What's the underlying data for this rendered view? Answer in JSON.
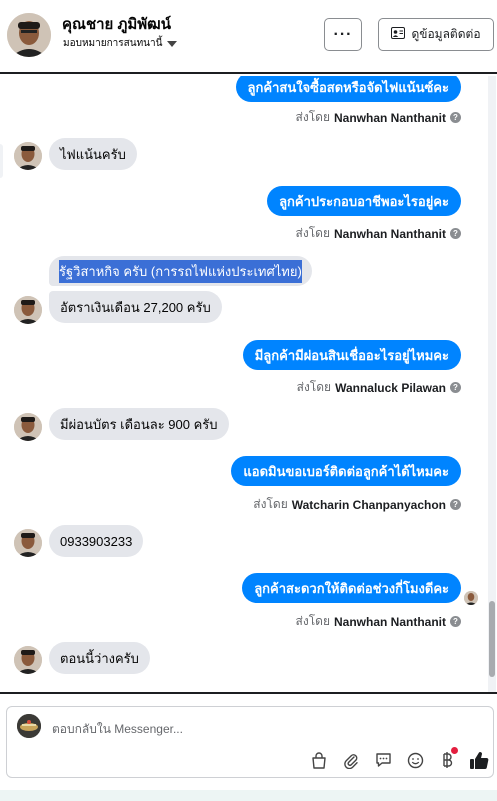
{
  "header": {
    "contact_name": "คุณชาย ภูมิพัฒน์",
    "assign_label": "มอบหมายการสนทนานี้",
    "more_label": "···",
    "contact_info_label": "ดูข้อมูลติดต่อ"
  },
  "messages": [
    {
      "dir": "out",
      "text": "ลูกค้าสนใจซื้อสดหรือจัดไฟแน้นซ์คะ",
      "sent_prefix": "ส่งโดย",
      "sender": "Nanwhan Nanthanit"
    },
    {
      "dir": "in",
      "text": "ไฟแน้นครับ"
    },
    {
      "dir": "out",
      "text": "ลูกค้าประกอบอาชีพอะไรอยู่คะ",
      "sent_prefix": "ส่งโดย",
      "sender": "Nanwhan Nanthanit"
    },
    {
      "dir": "in",
      "text": "รัฐวิสาหกิจ ครับ (การรถไฟแห่งประเทศไทย)",
      "highlighted": true
    },
    {
      "dir": "in",
      "text": "อัตราเงินเดือน 27,200 ครับ"
    },
    {
      "dir": "out",
      "text": "มีลูกค้ามีผ่อนสินเชื่ออะไรอยู่ไหมคะ",
      "sent_prefix": "ส่งโดย",
      "sender": "Wannaluck Pilawan"
    },
    {
      "dir": "in",
      "text": "มีผ่อนบัตร เดือนละ 900 ครับ"
    },
    {
      "dir": "out",
      "text": "แอดมินขอเบอร์ติดต่อลูกค้าได้ไหมคะ",
      "sent_prefix": "ส่งโดย",
      "sender": "Watcharin Chanpanyachon"
    },
    {
      "dir": "in",
      "text": "0933903233"
    },
    {
      "dir": "out",
      "text": "ลูกค้าสะดวกให้ติดต่อช่วงกี่โมงดีคะ",
      "sent_prefix": "ส่งโดย",
      "sender": "Nanwhan Nanthanit"
    },
    {
      "dir": "in",
      "text": "ตอนนี้ว่างครับ"
    }
  ],
  "composer": {
    "placeholder": "ตอบกลับใน Messenger..."
  },
  "toolbar_icons": [
    "shopping-bag-icon",
    "paperclip-icon",
    "saved-reply-icon",
    "emoji-icon",
    "baht-payment-icon",
    "thumbs-up-icon"
  ],
  "colors": {
    "outgoing_bubble": "#0084ff",
    "incoming_bubble": "#e4e6eb",
    "notification_dot": "#e41e3f",
    "selection_highlight": "#3b6fd6"
  }
}
